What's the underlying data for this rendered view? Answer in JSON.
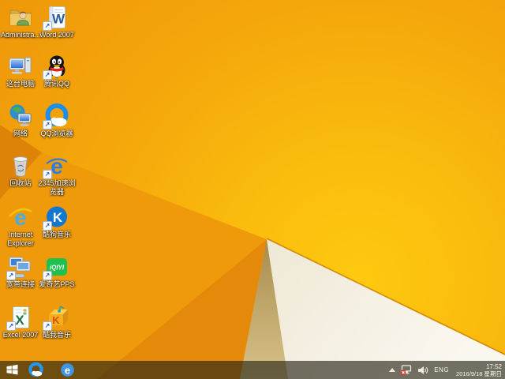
{
  "desktop": {
    "icons": [
      {
        "label": "Administra...",
        "name": "administrator-folder"
      },
      {
        "label": "Word 2007",
        "name": "word-2007"
      },
      {
        "label": "这台电脑",
        "name": "this-pc"
      },
      {
        "label": "腾讯QQ",
        "name": "tencent-qq"
      },
      {
        "label": "网络",
        "name": "network"
      },
      {
        "label": "QQ浏览器",
        "name": "qq-browser"
      },
      {
        "label": "回收站",
        "name": "recycle-bin"
      },
      {
        "label": "2345加速浏览器",
        "name": "2345-browser"
      },
      {
        "label": "Internet Explorer",
        "name": "internet-explorer"
      },
      {
        "label": "酷狗音乐",
        "name": "kugou-music"
      },
      {
        "label": "宽带连接",
        "name": "broadband-connection"
      },
      {
        "label": "爱奇艺PPS",
        "name": "iqiyi-pps"
      },
      {
        "label": "Excel 2007",
        "name": "excel-2007"
      },
      {
        "label": "酷我音乐",
        "name": "kuwo-music"
      }
    ],
    "shortcut_glyph": "↗"
  },
  "logo": {
    "word": "W",
    "excel": "X",
    "ie": "e",
    "e2345": "e",
    "kugou": "K",
    "kuwo": "K",
    "iqiyi": "iQIYI"
  },
  "taskbar": {
    "tray": {
      "language": "ENG",
      "time": "17:52",
      "date": "2016/9/18 星期日"
    }
  },
  "colors": {
    "wallpaper_orange": "#F4A60B",
    "wallpaper_yellow": "#FDC80F",
    "facet_dark": "#DC8308",
    "facet_khaki": "#B2975A",
    "facet_white": "#F6F1E5",
    "taskbar_tint": "#262214",
    "tray_text": "#F7F4EC"
  }
}
